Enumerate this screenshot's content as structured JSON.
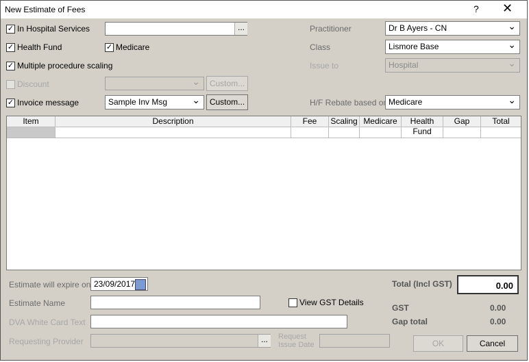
{
  "window": {
    "title": "New Estimate of Fees",
    "help": "?",
    "close": "✕"
  },
  "options": {
    "in_hospital_label": "In Hospital Services",
    "in_hospital_checked": true,
    "in_hospital_value": "",
    "health_fund_label": "Health Fund",
    "health_fund_checked": true,
    "medicare_label": "Medicare",
    "medicare_checked": true,
    "multi_proc_label": "Multiple procedure scaling",
    "multi_proc_checked": true,
    "discount_label": "Discount",
    "discount_custom": "Custom...",
    "invoice_msg_label": "Invoice message",
    "invoice_msg_checked": true,
    "invoice_msg_value": "Sample Inv Msg",
    "invoice_custom": "Custom...",
    "ellipsis": "..."
  },
  "right": {
    "practitioner_label": "Practitioner",
    "practitioner_value": "Dr B Ayers - CN",
    "class_label": "Class",
    "class_value": "Lismore Base",
    "issue_to_label": "Issue to",
    "issue_to_value": "Hospital",
    "rebate_label": "H/F Rebate based on",
    "rebate_value": "Medicare"
  },
  "grid": {
    "columns": [
      "Item",
      "Description",
      "Fee",
      "Scaling",
      "Medicare",
      "Health Fund",
      "Gap",
      "Total"
    ]
  },
  "bottom": {
    "expire_label": "Estimate will expire on",
    "expire_value": "23/09/2017",
    "name_label": "Estimate Name",
    "name_value": "",
    "dva_label": "DVA White Card Text",
    "dva_value": "",
    "provider_label": "Requesting Provider",
    "req_issue_label_1": "Request",
    "req_issue_label_2": "Issue Date",
    "view_gst_label": "View GST Details",
    "total_label": "Total (Incl GST)",
    "total_value": "0.00",
    "gst_label": "GST",
    "gst_value": "0.00",
    "gap_total_label": "Gap total",
    "gap_total_value": "0.00",
    "ok_label": "OK",
    "cancel_label": "Cancel"
  }
}
